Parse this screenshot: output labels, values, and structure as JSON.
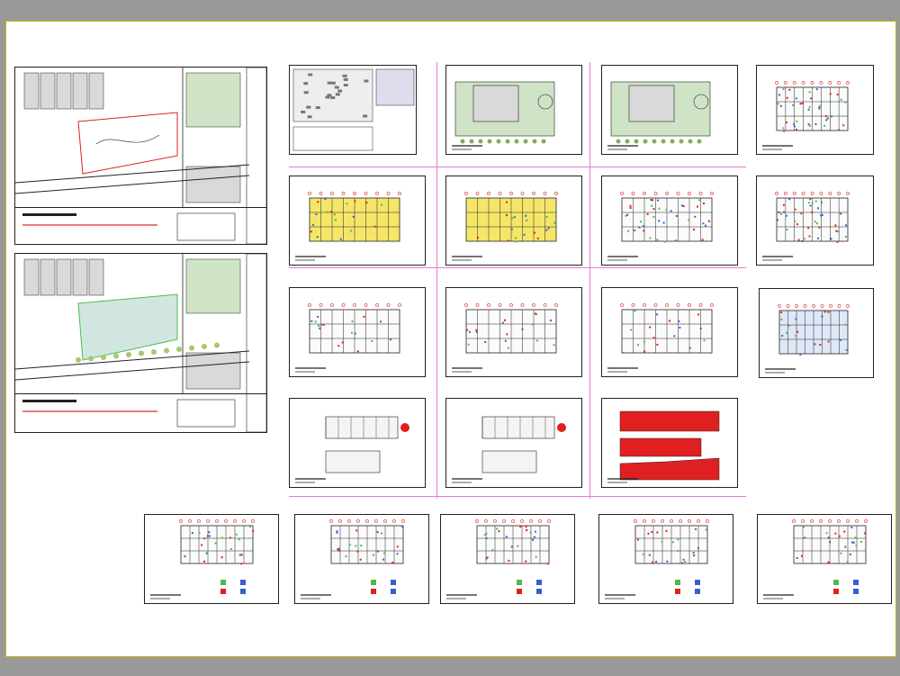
{
  "drawing_set": {
    "title": "",
    "colors": {
      "background": "#999999",
      "paper": "#ffffff",
      "paper_border": "#c8b400",
      "line": "#222222",
      "guide": "#e879d4",
      "accent_red": "#e02020",
      "accent_yellow": "#f5e66a",
      "accent_green": "#4cbb4c",
      "accent_blue": "#3a5fcd",
      "site_gray": "#d9d9d9",
      "grass": "#cfe3c6",
      "hatch": "#7ab7a8"
    },
    "sheets": [
      {
        "id": "site-location-plan",
        "kind": "site"
      },
      {
        "id": "site-proposal-plan",
        "kind": "site-hatch"
      },
      {
        "id": "location-map-sheet",
        "kind": "location"
      },
      {
        "id": "roof-plan-1",
        "kind": "roof"
      },
      {
        "id": "roof-plan-2",
        "kind": "roof"
      },
      {
        "id": "general-plan-1",
        "kind": "plan-color"
      },
      {
        "id": "floor-plan-a",
        "kind": "plan-yellow"
      },
      {
        "id": "floor-plan-b",
        "kind": "plan-yellow"
      },
      {
        "id": "furnished-plan-1",
        "kind": "plan-color"
      },
      {
        "id": "furnished-plan-2",
        "kind": "plan-color"
      },
      {
        "id": "distribution-plan-1",
        "kind": "plan-red"
      },
      {
        "id": "distribution-plan-2",
        "kind": "plan-red"
      },
      {
        "id": "distribution-plan-3",
        "kind": "plan-red"
      },
      {
        "id": "detail-plan-1",
        "kind": "plan-blue"
      },
      {
        "id": "sections-sheet-1",
        "kind": "section"
      },
      {
        "id": "sections-sheet-2",
        "kind": "section"
      },
      {
        "id": "elevations-sheet",
        "kind": "elevation"
      },
      {
        "id": "installation-plan-1",
        "kind": "install"
      },
      {
        "id": "installation-plan-2",
        "kind": "install"
      },
      {
        "id": "installation-plan-3",
        "kind": "install"
      },
      {
        "id": "installation-plan-4",
        "kind": "install"
      },
      {
        "id": "installation-plan-5",
        "kind": "install"
      }
    ]
  }
}
